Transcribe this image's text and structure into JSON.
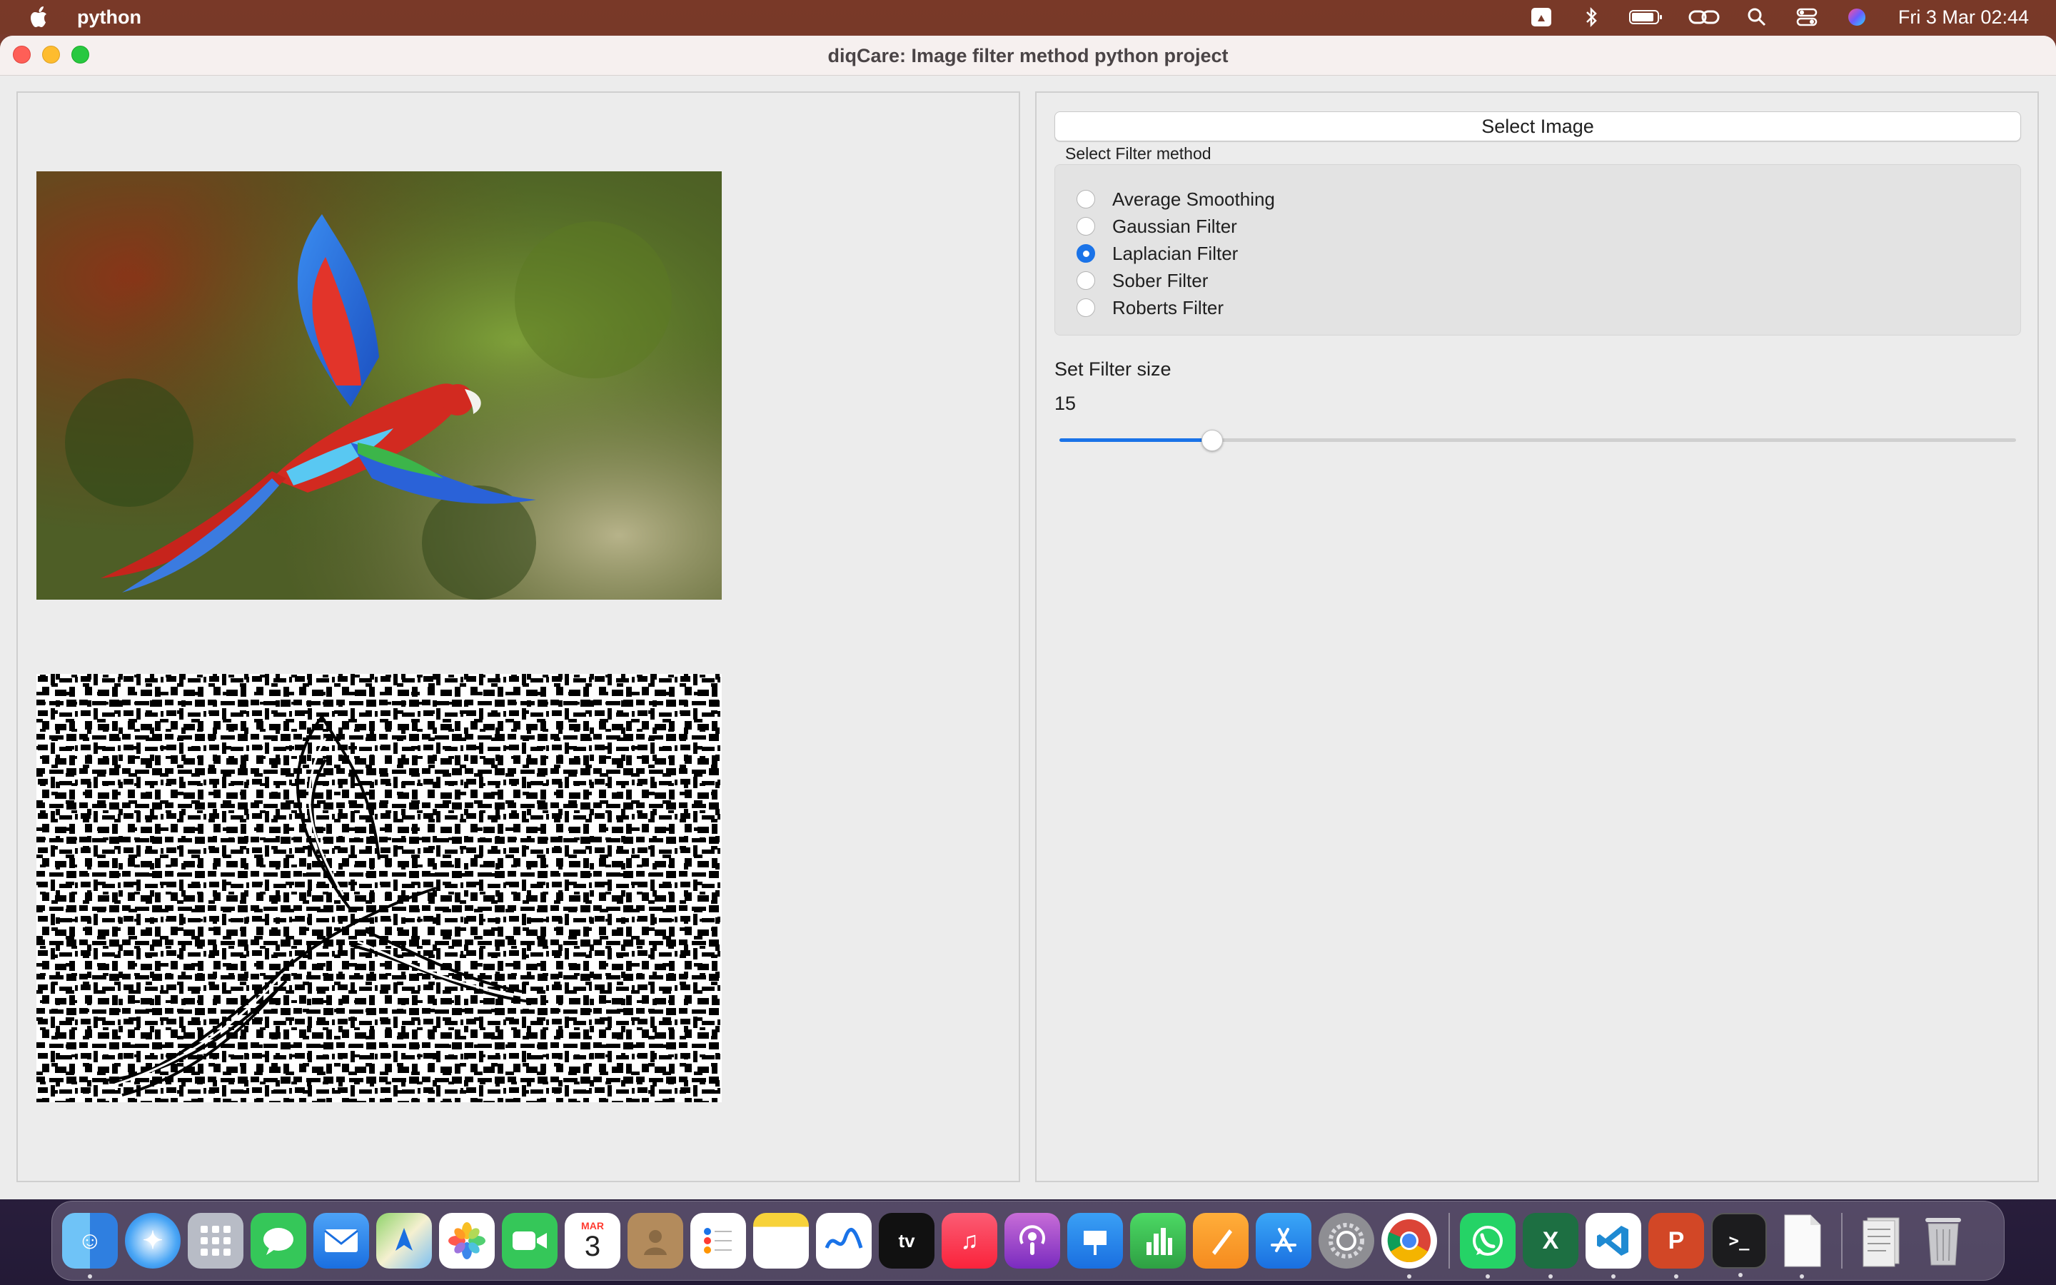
{
  "menubar": {
    "app_name": "python",
    "clock": "Fri 3 Mar  02:44"
  },
  "window": {
    "title": "diqCare: Image filter method python project"
  },
  "controls": {
    "select_image_label": "Select Image",
    "filter_group_label": "Select Filter method",
    "filter_options": [
      {
        "label": "Average Smoothing",
        "checked": false
      },
      {
        "label": "Gaussian Filter",
        "checked": false
      },
      {
        "label": "Laplacian Filter",
        "checked": true
      },
      {
        "label": "Sober Filter",
        "checked": false
      },
      {
        "label": "Roberts Filter",
        "checked": false
      }
    ],
    "filter_size_label": "Set Filter size",
    "filter_size_value": "15",
    "slider_fraction": 0.16
  },
  "colors": {
    "accent": "#1a73e8"
  },
  "dock": {
    "calendar_month": "MAR",
    "calendar_day": "3",
    "items": [
      {
        "name": "finder",
        "icon": "finder-icon"
      },
      {
        "name": "safari",
        "icon": "safari-icon"
      },
      {
        "name": "launchpad",
        "icon": "launchpad-icon"
      },
      {
        "name": "messages",
        "icon": "messages-icon"
      },
      {
        "name": "mail",
        "icon": "mail-icon"
      },
      {
        "name": "maps",
        "icon": "maps-icon"
      },
      {
        "name": "photos",
        "icon": "photos-icon"
      },
      {
        "name": "facetime",
        "icon": "facetime-icon"
      },
      {
        "name": "calendar",
        "icon": "calendar-icon"
      },
      {
        "name": "contacts",
        "icon": "contacts-icon"
      },
      {
        "name": "reminders",
        "icon": "reminders-icon"
      },
      {
        "name": "notes",
        "icon": "notes-icon"
      },
      {
        "name": "freeform",
        "icon": "freeform-icon"
      },
      {
        "name": "apple-tv",
        "icon": "apple-tv-icon"
      },
      {
        "name": "music",
        "icon": "music-icon"
      },
      {
        "name": "podcasts",
        "icon": "podcasts-icon"
      },
      {
        "name": "keynote",
        "icon": "keynote-icon"
      },
      {
        "name": "numbers",
        "icon": "numbers-icon"
      },
      {
        "name": "pages",
        "icon": "pages-icon"
      },
      {
        "name": "app-store",
        "icon": "app-store-icon"
      },
      {
        "name": "system-settings",
        "icon": "gear-icon"
      },
      {
        "name": "chrome",
        "icon": "chrome-icon"
      },
      {
        "name": "whatsapp",
        "icon": "whatsapp-icon"
      },
      {
        "name": "excel",
        "icon": "excel-icon"
      },
      {
        "name": "vscode",
        "icon": "vscode-icon"
      },
      {
        "name": "powerpoint",
        "icon": "powerpoint-icon"
      },
      {
        "name": "terminal",
        "icon": "terminal-icon"
      },
      {
        "name": "document",
        "icon": "document-icon"
      },
      {
        "name": "downloads",
        "icon": "downloads-stack-icon"
      },
      {
        "name": "trash",
        "icon": "trash-icon"
      }
    ]
  }
}
